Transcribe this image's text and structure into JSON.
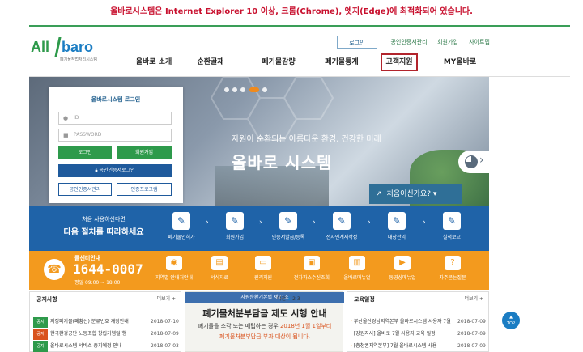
{
  "notice": "올바로시스템은 Internet Explorer 10 이상, 크롬(Chrome), 엣지(Edge)에 최적화되어 있습니다.",
  "logo": {
    "part1": "All",
    "part2": "baro",
    "subtitle": "폐기물적법처리시스템"
  },
  "util": {
    "login": "로그인",
    "cert": "공인인증서관리",
    "join": "회원가입",
    "sitemap": "사이트맵"
  },
  "gnb": [
    "올바로 소개",
    "순환골재",
    "폐기물감량",
    "폐기물통계",
    "고객지원",
    "MY올바로"
  ],
  "hero": {
    "slogan": "자원이 순환되는 아름다운 환경, 건강한 미래",
    "title": "올바로 시스템",
    "first_visit": "처음이신가요?"
  },
  "login": {
    "title": "올바로시스템 로그인",
    "id_placeholder": "ID",
    "pw_placeholder": "PASSWORD",
    "login_btn": "로그인",
    "join_btn": "회원가입",
    "cert_login_btn": "공인인증서로그인",
    "cert_mgmt_btn": "공인인증서관리",
    "cert_prog_btn": "인증프로그램"
  },
  "steps": {
    "intro_line1": "처음 사용하신다면",
    "intro_line2": "다음 절차를 따라하세요",
    "items": [
      "폐기물인허가",
      "회원가입",
      "인증서발급/등록",
      "전자인계서작성",
      "대장관리",
      "실적보고"
    ]
  },
  "help": {
    "title": "콜센터안내",
    "number": "1644-0007",
    "hours": "평일 09:00 ~ 18:00",
    "items": [
      "지역별 안내처안내",
      "서식자료",
      "원격지원",
      "전자파스수신조회",
      "올바로매뉴얼",
      "동영상매뉴얼",
      "자주묻는질문"
    ]
  },
  "notice_panel": {
    "title": "공지사항",
    "more": "더보기 +",
    "rows": [
      {
        "tag": "공지",
        "text": "지정폐기물(폐황산) 분류번호 개정안내",
        "date": "2018-07-10"
      },
      {
        "tag": "공지",
        "text": "한국환경공단 노동조합 창립기념일 행",
        "date": "2018-07-09"
      },
      {
        "tag": "공지",
        "text": "올바로시스템 서비스 중지예정 안내",
        "date": "2018-07-03"
      }
    ]
  },
  "banner": {
    "tag": "자원순환기본법 제21조",
    "headline": "폐기물처분부담금 제도 시행 안내",
    "line1_a": "폐기물을 소각 또는 매립하는 경우 ",
    "line1_b": "2018년 1월 1일부터",
    "line2": "폐기물처분부담금 부과 대상이 됩니다.",
    "pager_label": "이전",
    "pager_pages": [
      "1",
      "2",
      "3"
    ]
  },
  "edu_panel": {
    "title": "교육일정",
    "more": "더보기 +",
    "rows": [
      {
        "text": "부산울산경남지역본부 올바로시스템 사용자 7월",
        "date": "2018-07-09"
      },
      {
        "text": "[강원지사] 올바로 7월 사용자 교육 일정",
        "date": "2018-07-09"
      },
      {
        "text": "[충청권지역본부] 7월 올바로시스템 사용",
        "date": "2018-07-09"
      }
    ]
  },
  "top_button": "TOP",
  "colors": {
    "brand_green": "#2e9a4b",
    "brand_blue": "#1f63a8",
    "orange": "#f39a1e",
    "alert_red": "#c8102e"
  }
}
